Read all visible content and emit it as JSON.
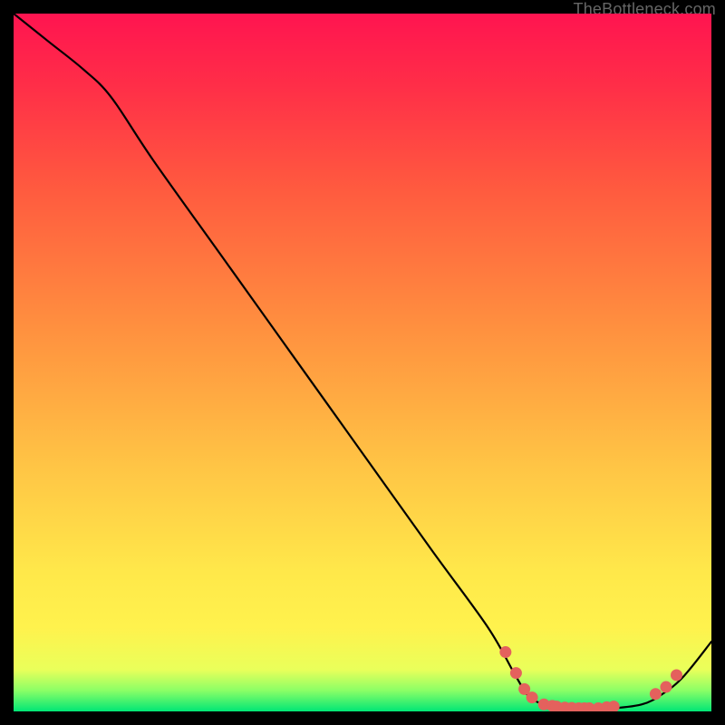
{
  "watermark": "TheBottleneck.com",
  "chart_data": {
    "type": "line",
    "title": "",
    "xlabel": "",
    "ylabel": "",
    "xlim": [
      0,
      100
    ],
    "ylim": [
      0,
      100
    ],
    "grid": false,
    "legend": false,
    "gradient_stops": [
      {
        "t": 0,
        "color": "#00e676"
      },
      {
        "t": 0.03,
        "color": "#8bff66"
      },
      {
        "t": 0.06,
        "color": "#eaff5a"
      },
      {
        "t": 0.12,
        "color": "#fff24d"
      },
      {
        "t": 0.2,
        "color": "#ffe84a"
      },
      {
        "t": 0.35,
        "color": "#ffc545"
      },
      {
        "t": 0.55,
        "color": "#ff903f"
      },
      {
        "t": 0.75,
        "color": "#ff5a3f"
      },
      {
        "t": 0.9,
        "color": "#ff2d48"
      },
      {
        "t": 1.0,
        "color": "#ff1450"
      }
    ],
    "series": [
      {
        "name": "bottleneck-curve",
        "points": [
          {
            "x": 0,
            "y": 100
          },
          {
            "x": 5,
            "y": 96
          },
          {
            "x": 10,
            "y": 92
          },
          {
            "x": 14,
            "y": 88
          },
          {
            "x": 20,
            "y": 79
          },
          {
            "x": 30,
            "y": 65
          },
          {
            "x": 40,
            "y": 51
          },
          {
            "x": 50,
            "y": 37
          },
          {
            "x": 60,
            "y": 23
          },
          {
            "x": 68,
            "y": 12
          },
          {
            "x": 72,
            "y": 5
          },
          {
            "x": 74,
            "y": 2
          },
          {
            "x": 77,
            "y": 0.7
          },
          {
            "x": 80,
            "y": 0.4
          },
          {
            "x": 85,
            "y": 0.4
          },
          {
            "x": 90,
            "y": 1.0
          },
          {
            "x": 93,
            "y": 2.5
          },
          {
            "x": 96,
            "y": 5
          },
          {
            "x": 100,
            "y": 10
          }
        ]
      }
    ],
    "scatter": {
      "name": "highlight-dots",
      "color": "#e4615d",
      "points": [
        {
          "x": 70.5,
          "y": 8.5
        },
        {
          "x": 72.0,
          "y": 5.5
        },
        {
          "x": 73.2,
          "y": 3.2
        },
        {
          "x": 74.3,
          "y": 2.0
        },
        {
          "x": 76.0,
          "y": 1.0
        },
        {
          "x": 77.2,
          "y": 0.8
        },
        {
          "x": 77.8,
          "y": 0.7
        },
        {
          "x": 79.0,
          "y": 0.55
        },
        {
          "x": 80.0,
          "y": 0.5
        },
        {
          "x": 81.0,
          "y": 0.45
        },
        {
          "x": 81.8,
          "y": 0.45
        },
        {
          "x": 82.5,
          "y": 0.45
        },
        {
          "x": 83.8,
          "y": 0.45
        },
        {
          "x": 85.0,
          "y": 0.6
        },
        {
          "x": 86.0,
          "y": 0.7
        },
        {
          "x": 92.0,
          "y": 2.5
        },
        {
          "x": 93.5,
          "y": 3.5
        },
        {
          "x": 95.0,
          "y": 5.2
        }
      ]
    }
  }
}
